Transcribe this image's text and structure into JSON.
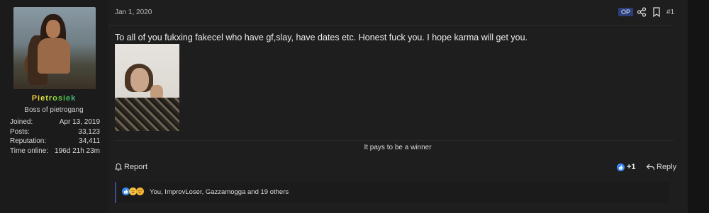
{
  "user": {
    "name": "Pietrosiek",
    "title": "Boss of pietrogang",
    "stats": [
      {
        "label": "Joined:",
        "value": "Apr 13, 2019"
      },
      {
        "label": "Posts:",
        "value": "33,123"
      },
      {
        "label": "Reputation:",
        "value": "34,411"
      },
      {
        "label": "Time online:",
        "value": "196d 21h 23m"
      }
    ]
  },
  "post": {
    "date": "Jan 1, 2020",
    "op_badge": "OP",
    "number": "#1",
    "text": "To all of you fukxing fakecel who have gf,slay, have dates etc. Honest fuck you. I hope karma will get you.",
    "signature": "It pays to be a winner",
    "report_label": "Report",
    "reaction_score": "+1",
    "reply_label": "Reply",
    "reactions_text": "You, ImprovLoser, Gazzamogga and 19 others"
  },
  "icons": {
    "share": "share-icon",
    "bookmark": "bookmark-icon",
    "report": "bell-icon",
    "like": "like-icon",
    "reply": "reply-icon"
  },
  "colors": {
    "background": "#141414",
    "post_background": "#1e1e1e",
    "accent": "#2c3f7a",
    "like": "#3d8af7"
  }
}
